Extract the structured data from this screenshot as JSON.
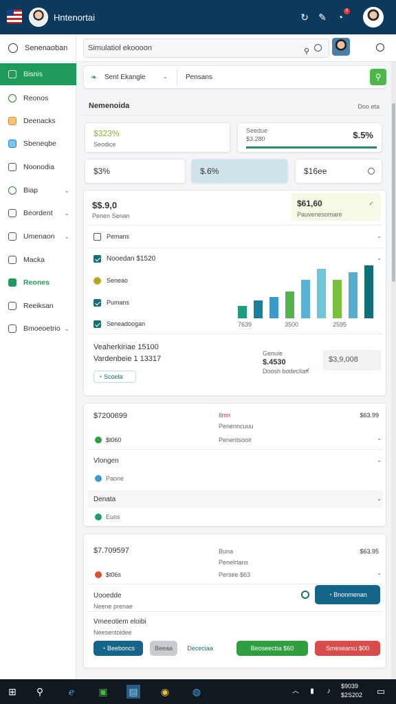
{
  "titlebar": {
    "title": "Hntenortai",
    "notification_count": "9"
  },
  "sidebar": {
    "search_label": "Senenaoban",
    "items": [
      {
        "label": "Bisnis"
      },
      {
        "label": "Reonos"
      },
      {
        "label": "Deenacks"
      },
      {
        "label": "Sbeneqbe"
      },
      {
        "label": "Noonodia"
      },
      {
        "label": "Biap"
      },
      {
        "label": "Beordent"
      },
      {
        "label": "Umenaon"
      },
      {
        "label": "Macka"
      },
      {
        "label": "Reones"
      },
      {
        "label": "Reeiksan"
      },
      {
        "label": "Bmoeoetrio"
      }
    ]
  },
  "toolbar": {
    "search_value": "Simulatiol ekoooon"
  },
  "filter": {
    "select_label": "Sent Ekangle",
    "text": "Pensans"
  },
  "section": {
    "title": "Nemenoida",
    "right": "Doo eta"
  },
  "stats": {
    "s1_value": "$323%",
    "s1_label": "Seodice",
    "s2_label": "Seedue",
    "s2_sub": "$3.280",
    "s2_value": "$.5%",
    "s3_value": "$3%",
    "s4_value": "$.6%",
    "s5_value": "$16ee"
  },
  "panel": {
    "value": "$$.9,0",
    "sub": "Penen Senan",
    "highlight_value": "$61,60",
    "highlight_sub": "Pauvenesomare",
    "rows": [
      {
        "label": "Pemans"
      },
      {
        "label": "Nooedan $1520"
      },
      {
        "label": "Seneao"
      },
      {
        "label": "Pumans"
      },
      {
        "label": "Seneadoogan"
      }
    ],
    "chart_xticks": [
      "7639",
      "3500",
      "2595"
    ],
    "v1": "Veaherkiriae 15100",
    "v2": "Vardenbeie 1 13317",
    "chip": "Scoela",
    "mini_label": "Genuie",
    "mini_value": "$.4530",
    "mini_sub": "Doosh bodecllan",
    "box_value": "$3,9,008"
  },
  "chart_data": {
    "type": "bar",
    "categories": [
      "",
      "",
      "",
      "",
      "",
      "",
      "",
      "",
      ""
    ],
    "values": [
      18,
      25,
      30,
      38,
      55,
      70,
      55,
      65,
      75
    ],
    "colors": [
      "#1f9a7e",
      "#1a7f9a",
      "#3a9ac8",
      "#53b350",
      "#5ab1d6",
      "#6ec6d8",
      "#7bbf3e",
      "#55b0cf",
      "#0f6f7a"
    ],
    "xticks": [
      "7639",
      "3500",
      "2595"
    ]
  },
  "card2": {
    "amount": "$7200699",
    "red_label": "Ilmn",
    "label2": "Penenncuuu",
    "right_value": "$63.99",
    "sub": "$t060",
    "sub2": "Penentsooit",
    "group1": "Vlongen",
    "group1_sub": "Paone",
    "group2": "Denata",
    "group2_sub": "Euos"
  },
  "card3": {
    "amount": "$7.709597",
    "label": "Buna",
    "label2": "Penelrtans",
    "right_value": "$63.95",
    "sub": "$t06s",
    "sub2": "Persee $63",
    "group1": "Uooedde",
    "group1_sub": "Neene prenae",
    "primary_btn": "Bnonmenan",
    "group2": "Vmeeotiem eloibi",
    "group2_sub": "Neesentoidee",
    "btn1": "Beeboncs",
    "btn2": "Beeaa",
    "btn3": "Dececiaa",
    "btn4": "Beoseecba   $60",
    "btn5": "Smesearsu   $00"
  },
  "taskbar": {
    "time": "$9039",
    "date": "$2S202"
  }
}
